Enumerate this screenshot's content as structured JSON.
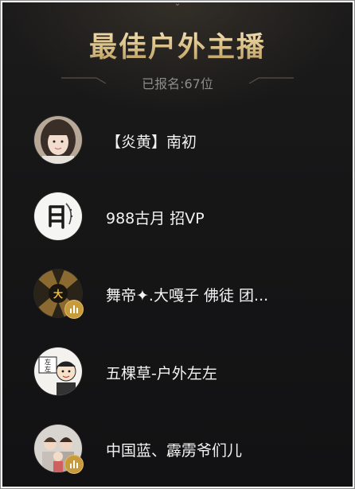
{
  "header": {
    "title": "最佳户外主播",
    "subtitle": "已报名:67位",
    "accent_color": "#d9bf86"
  },
  "streamers": [
    {
      "name": "【炎黄】南初",
      "avatar_icon": "girl-photo-avatar",
      "live": false
    },
    {
      "name": "988古月 招VP",
      "avatar_icon": "calligraphy-avatar",
      "live": false
    },
    {
      "name": "舞帝✦.大嘎子 佛徒 团...",
      "avatar_icon": "golden-logo-avatar",
      "live": true
    },
    {
      "name": "五棵草-户外左左",
      "avatar_icon": "cartoon-avatar",
      "live": false
    },
    {
      "name": "中国蓝、霹雳爷们儿",
      "avatar_icon": "group-photo-avatar",
      "live": true
    }
  ],
  "colors": {
    "background": "#161617",
    "live_badge": "#c79a3c",
    "name_text": "#f2f2f2",
    "subtitle_text": "#8c8c8c"
  }
}
